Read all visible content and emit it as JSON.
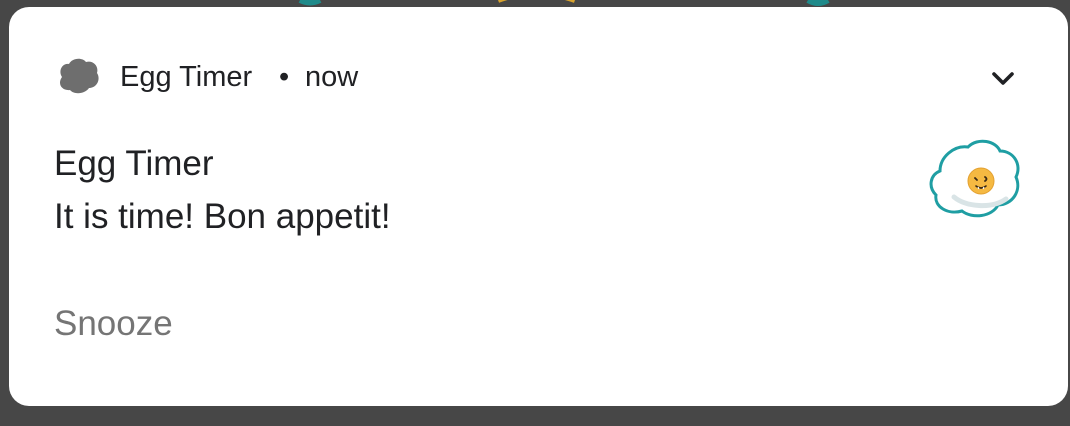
{
  "notification": {
    "app_name": "Egg Timer",
    "separator": "•",
    "time": "now",
    "title": "Egg Timer",
    "text": "It is time! Bon appetit!",
    "action_label": "Snooze",
    "app_icon": "cooking-egg-icon",
    "expand_icon": "chevron-down-icon",
    "large_icon": "fried-egg-icon"
  },
  "colors": {
    "scrim": "#474747",
    "card": "#ffffff",
    "primary_text": "#202124",
    "action_text": "#757575",
    "egg_outline": "#1f9ea3",
    "yolk": "#f5b942"
  }
}
